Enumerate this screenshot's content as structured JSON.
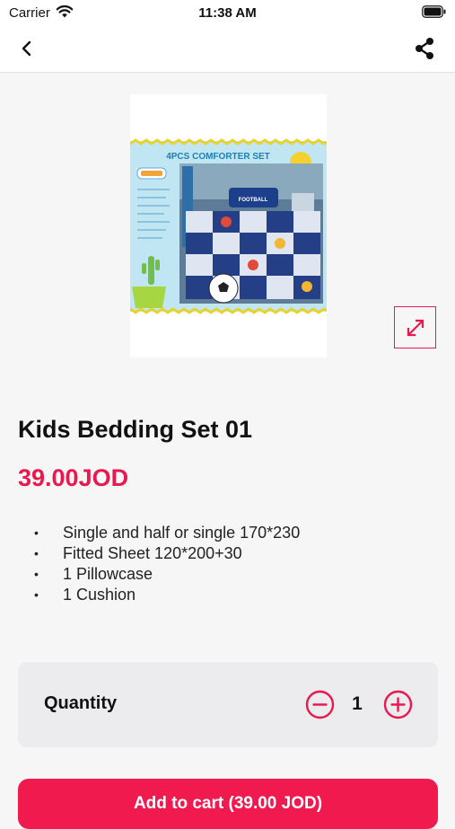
{
  "status_bar": {
    "carrier": "Carrier",
    "time": "11:38 AM"
  },
  "nav": {
    "back_icon": "chevron-left-icon",
    "share_icon": "share-icon"
  },
  "product": {
    "image": {
      "banner_text": "4PCS COMFORTER SET",
      "pillow_text": "FOOTBALL"
    },
    "expand_icon": "expand-diagonal-icon",
    "title": "Kids Bedding Set 01",
    "price": "39.00JOD",
    "features": [
      "Single and half or single 170*230",
      "Fitted Sheet 120*200+30",
      "1 Pillowcase",
      "1 Cushion"
    ],
    "bullet": "•"
  },
  "quantity": {
    "label": "Quantity",
    "value": "1",
    "minus_icon": "minus-circle-icon",
    "plus_icon": "plus-circle-icon"
  },
  "cart": {
    "button_label": "Add to cart (39.00 JOD)"
  },
  "colors": {
    "accent": "#e8194f",
    "background": "#f6f6f6",
    "card": "#ececee"
  }
}
